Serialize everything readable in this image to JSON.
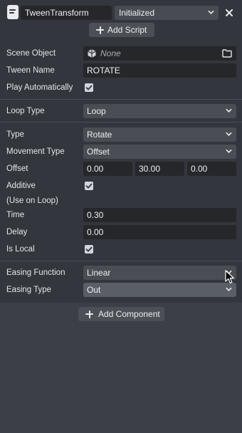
{
  "header": {
    "script_name": "TweenTransform",
    "status": "Initialized",
    "add_script_label": "Add Script"
  },
  "fields": {
    "scene_object": {
      "label": "Scene Object",
      "value": "None"
    },
    "tween_name": {
      "label": "Tween Name",
      "value": "ROTATE"
    },
    "play_automatically": {
      "label": "Play Automatically",
      "checked": true
    },
    "loop_type": {
      "label": "Loop Type",
      "value": "Loop"
    },
    "type": {
      "label": "Type",
      "value": "Rotate"
    },
    "movement_type": {
      "label": "Movement Type",
      "value": "Offset"
    },
    "offset": {
      "label": "Offset",
      "x": "0.00",
      "y": "30.00",
      "z": "0.00"
    },
    "additive": {
      "label": "Additive",
      "sublabel": "(Use on Loop)",
      "checked": true
    },
    "time": {
      "label": "Time",
      "value": "0.30"
    },
    "delay": {
      "label": "Delay",
      "value": "0.00"
    },
    "is_local": {
      "label": "Is Local",
      "checked": true
    },
    "easing_function": {
      "label": "Easing Function",
      "value": "Linear"
    },
    "easing_type": {
      "label": "Easing Type",
      "value": "Out"
    }
  },
  "footer": {
    "add_component_label": "Add Component"
  },
  "icons": {
    "script": "script-file-icon",
    "status_dropdown": "chevron-down-icon",
    "close": "close-icon",
    "scene_object_type": "scene-object-icon",
    "folder": "folder-icon",
    "check": "check-icon",
    "add": "plus-icon",
    "cursor": "mouse-pointer-icon"
  },
  "colors": {
    "panel_bg": "#33363c",
    "page_bg": "#3c3f46",
    "input_bg": "#25272b",
    "select_bg": "#4a4d54",
    "text": "#e4e6ea"
  }
}
